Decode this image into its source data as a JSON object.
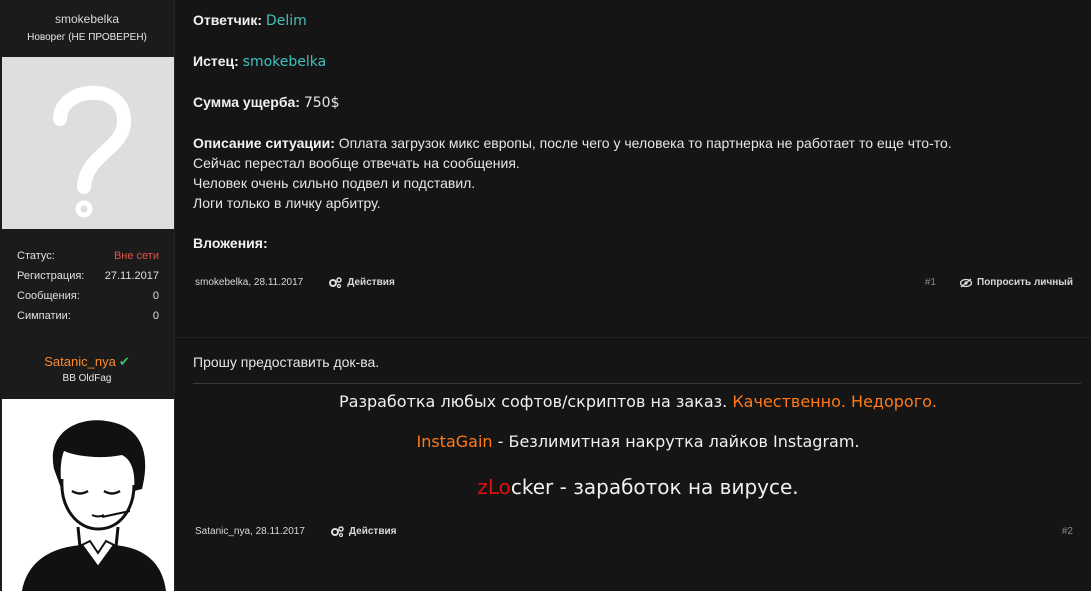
{
  "posts": [
    {
      "author": "smokebelka",
      "user_title": "Новорег (НЕ ПРОВЕРЕН)",
      "stats": [
        {
          "label": "Статус:",
          "value": "Вне сети"
        },
        {
          "label": "Регистрация:",
          "value": "27.11.2017"
        },
        {
          "label": "Сообщения:",
          "value": "0"
        },
        {
          "label": "Симпатии:",
          "value": "0"
        }
      ],
      "fields": {
        "defendant_label": "Ответчик:",
        "defendant_value": "Delim",
        "plaintiff_label": "Истец:",
        "plaintiff_value": "smokebelka",
        "damage_label": "Сумма ущерба:",
        "damage_value": "750$",
        "desc_label": "Описание ситуации:",
        "desc_line1": "Оплата загрузок микс европы, после чего у человека то партнерка не работает то еще что-то.",
        "desc_line2": "Сейчас перестал вообще отвечать на сообщения.",
        "desc_line3": "Человек очень сильно подвел и подставил.",
        "desc_line4": "Логи только в личку арбитру.",
        "attachments_label": "Вложения:"
      },
      "footer": {
        "meta": "smokebelka, 28.11.2017",
        "actions": "Действия",
        "number": "#1",
        "pm": "Попросить личный"
      }
    },
    {
      "author": "Satanic_nya",
      "user_title": "BB OldFag",
      "message": "Прошу предоставить док-ва.",
      "signature": {
        "line1_text": "Разработка любых софтов/скриптов на заказ.",
        "line1_accent": "Качественно. Недорого.",
        "line2_accent": "InstaGain",
        "line2_text": "- Безлимитная накрутка лайков Instagram.",
        "line3_red": "zLo",
        "line3_rest": "cker",
        "line3_text": "- заработок на вирусе."
      },
      "footer": {
        "meta": "Satanic_nya, 28.11.2017",
        "actions": "Действия",
        "number": "#2"
      }
    }
  ],
  "colors": {
    "accent_teal": "#3fc1c0",
    "offline_red": "#e0524c",
    "orange": "#ff7a1a",
    "verified_green": "#35c46a"
  }
}
